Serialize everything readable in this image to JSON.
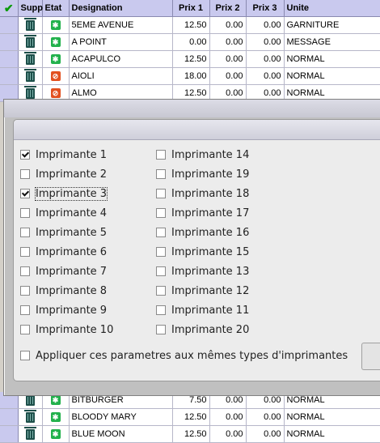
{
  "grid": {
    "header": {
      "check_glyph": "✔",
      "supp": "Supp",
      "etat": "Etat",
      "designation": "Designation",
      "prix1": "Prix 1",
      "prix2": "Prix 2",
      "prix3": "Prix 3",
      "unite": "Unite"
    },
    "rows_top": [
      {
        "etat": "ok",
        "designation": "5EME AVENUE",
        "prix1": "12.50",
        "prix2": "0.00",
        "prix3": "0.00",
        "unite": "GARNITURE"
      },
      {
        "etat": "ok",
        "designation": "A POINT",
        "prix1": "0.00",
        "prix2": "0.00",
        "prix3": "0.00",
        "unite": "MESSAGE"
      },
      {
        "etat": "ok",
        "designation": "ACAPULCO",
        "prix1": "12.50",
        "prix2": "0.00",
        "prix3": "0.00",
        "unite": "NORMAL"
      },
      {
        "etat": "stop",
        "designation": "AIOLI",
        "prix1": "18.00",
        "prix2": "0.00",
        "prix3": "0.00",
        "unite": "NORMAL"
      },
      {
        "etat": "stop",
        "designation": "ALMO",
        "prix1": "12.50",
        "prix2": "0.00",
        "prix3": "0.00",
        "unite": "NORMAL"
      }
    ],
    "rows_bottom": [
      {
        "etat": "ok",
        "designation": "BITBURGER",
        "prix1": "7.50",
        "prix2": "0.00",
        "prix3": "0.00",
        "unite": "NORMAL"
      },
      {
        "etat": "ok",
        "designation": "BLOODY MARY",
        "prix1": "12.50",
        "prix2": "0.00",
        "prix3": "0.00",
        "unite": "NORMAL"
      },
      {
        "etat": "ok",
        "designation": "BLUE MOON",
        "prix1": "12.50",
        "prix2": "0.00",
        "prix3": "0.00",
        "unite": "NORMAL"
      }
    ]
  },
  "dialog": {
    "printers_left": [
      {
        "label": "Imprimante 1",
        "checked": true
      },
      {
        "label": "Imprimante 2",
        "checked": false
      },
      {
        "label": "Imprimante 3",
        "checked": true
      },
      {
        "label": "Imprimante 4",
        "checked": false
      },
      {
        "label": "Imprimante 5",
        "checked": false
      },
      {
        "label": "Imprimante 6",
        "checked": false
      },
      {
        "label": "Imprimante 7",
        "checked": false
      },
      {
        "label": "Imprimante 8",
        "checked": false
      },
      {
        "label": "Imprimante 9",
        "checked": false
      },
      {
        "label": "Imprimante 10",
        "checked": false
      }
    ],
    "printers_right": [
      {
        "label": "Imprimante 14",
        "checked": false
      },
      {
        "label": "Imprimante 19",
        "checked": false
      },
      {
        "label": "Imprimante 18",
        "checked": false
      },
      {
        "label": "Imprimante 17",
        "checked": false
      },
      {
        "label": "Imprimante 16",
        "checked": false
      },
      {
        "label": "Imprimante 15",
        "checked": false
      },
      {
        "label": "Imprimante 13",
        "checked": false
      },
      {
        "label": "Imprimante 12",
        "checked": false
      },
      {
        "label": "Imprimante 11",
        "checked": false
      },
      {
        "label": "Imprimante 20",
        "checked": false
      }
    ],
    "apply_same_types": {
      "label": "Appliquer ces parametres aux mêmes types d'imprimantes",
      "checked": false
    }
  },
  "colors": {
    "header_bg": "#c9c9ee",
    "status_ok": "#22b14c",
    "status_stop": "#e2501f",
    "panel_bg": "#ececec"
  }
}
